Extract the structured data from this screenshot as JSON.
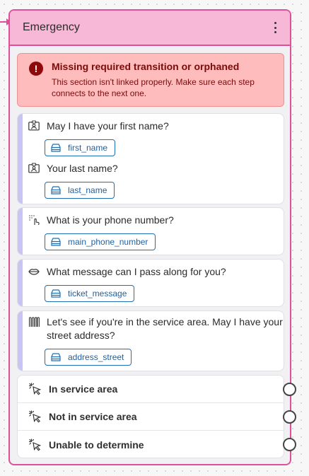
{
  "node": {
    "title": "Emergency",
    "menu_icon": "kebab-menu-icon"
  },
  "alert": {
    "icon": "error-icon",
    "icon_glyph": "!",
    "title": "Missing required transition or orphaned",
    "body_line1": "This section isn't linked properly. Make sure each step",
    "body_line2": "connects to the next one."
  },
  "steps": [
    {
      "questions": [
        {
          "icon": "contact-card-icon",
          "text": "May I have your first name?",
          "variable": "first_name"
        },
        {
          "icon": "contact-card-icon",
          "text": "Your last name?",
          "variable": "last_name"
        }
      ]
    },
    {
      "questions": [
        {
          "icon": "dial-tap-icon",
          "text": "What is your phone number?",
          "variable": "main_phone_number"
        }
      ]
    },
    {
      "questions": [
        {
          "icon": "lips-icon",
          "text": "What message can I pass along for you?",
          "variable": "ticket_message"
        }
      ]
    },
    {
      "questions": [
        {
          "icon": "address-columns-icon",
          "text": "Let's see if you're in the service area. May I have your street address?",
          "variable": "address_street"
        }
      ]
    }
  ],
  "transitions": [
    {
      "icon": "click-pointer-icon",
      "label": "In service area"
    },
    {
      "icon": "click-pointer-icon",
      "label": "Not in service area"
    },
    {
      "icon": "click-pointer-icon",
      "label": "Unable to determine"
    }
  ],
  "colors": {
    "accent": "#e0509a",
    "header_bg": "#f7b8d8",
    "alert_bg": "#ffbcbc",
    "alert_text": "#7a0b0b",
    "variable_border": "#1f6fb5",
    "step_bar": "#c8c4f4"
  }
}
